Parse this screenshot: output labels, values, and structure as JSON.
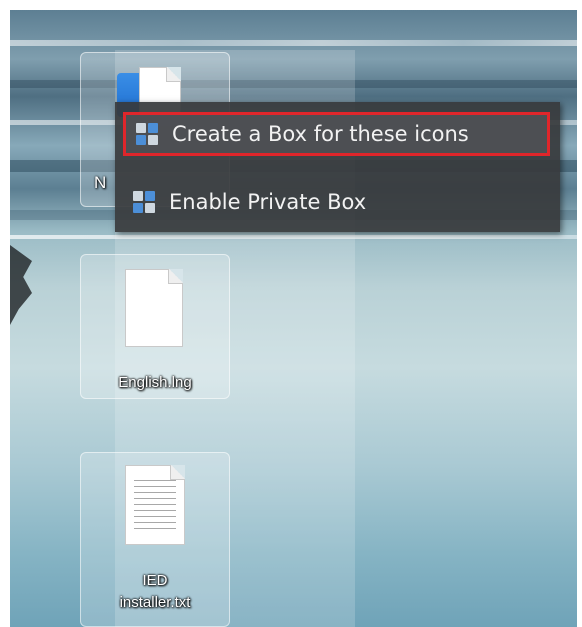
{
  "context_menu": {
    "items": [
      {
        "label": "Create a Box for these icons",
        "icon": "box-grid-icon",
        "highlighted": true
      },
      {
        "label": "Enable Private Box",
        "icon": "box-grid-icon",
        "highlighted": false
      }
    ],
    "highlight_color": "#e0262b"
  },
  "desktop": {
    "icons": [
      {
        "label": "N",
        "icon": "app-file-icon"
      },
      {
        "label": "English.lng",
        "icon": "blank-file-icon"
      },
      {
        "label": "IED installer.txt",
        "label_line1": "IED",
        "label_line2": "installer.txt",
        "icon": "text-file-icon"
      }
    ]
  }
}
